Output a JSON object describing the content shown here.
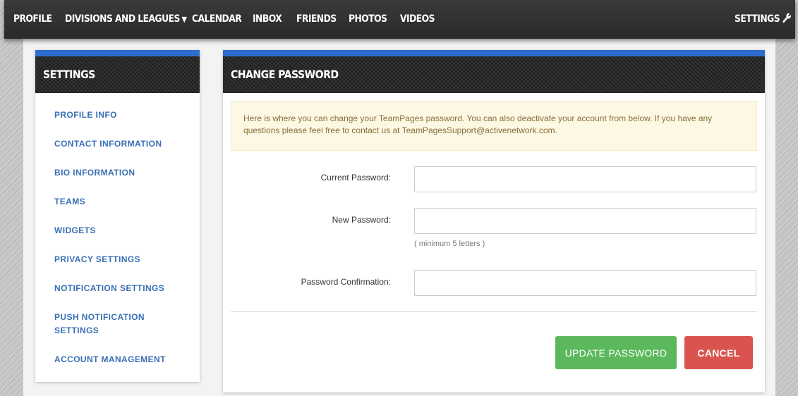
{
  "nav": {
    "profile": "PROFILE",
    "divisions": "DIVISIONS AND LEAGUES",
    "calendar": "CALENDAR",
    "inbox": "INBOX",
    "friends": "FRIENDS",
    "photos": "PHOTOS",
    "videos": "VIDEOS",
    "settings": "SETTINGS"
  },
  "sidebar": {
    "title": "SETTINGS",
    "items": [
      {
        "label": "PROFILE INFO"
      },
      {
        "label": "CONTACT INFORMATION"
      },
      {
        "label": "BIO INFORMATION"
      },
      {
        "label": "TEAMS"
      },
      {
        "label": "WIDGETS"
      },
      {
        "label": "PRIVACY SETTINGS"
      },
      {
        "label": "NOTIFICATION SETTINGS"
      },
      {
        "label": "PUSH NOTIFICATION SETTINGS"
      },
      {
        "label": "ACCOUNT MANAGEMENT"
      }
    ]
  },
  "main": {
    "title": "CHANGE PASSWORD",
    "info": "Here is where you can change your TeamPages password. You can also deactivate your account from below. If you have any questions please feel free to contact us at TeamPagesSupport@activenetwork.com.",
    "fields": {
      "current_label": "Current Password:",
      "current_value": "",
      "new_label": "New Password:",
      "new_value": "",
      "new_hint": "( minimum 5 letters )",
      "confirm_label": "Password Confirmation:",
      "confirm_value": ""
    },
    "buttons": {
      "update": "UPDATE PASSWORD",
      "cancel": "CANCEL"
    }
  },
  "colors": {
    "accent_blue": "#2d6dcd",
    "link_blue": "#3a6fb5",
    "success_green": "#5cb85c",
    "danger_red": "#d9534f",
    "info_bg": "#fcf8e3"
  },
  "icons": {
    "divisions_dropdown": "chevron-down-icon",
    "settings": "wrench-icon"
  }
}
